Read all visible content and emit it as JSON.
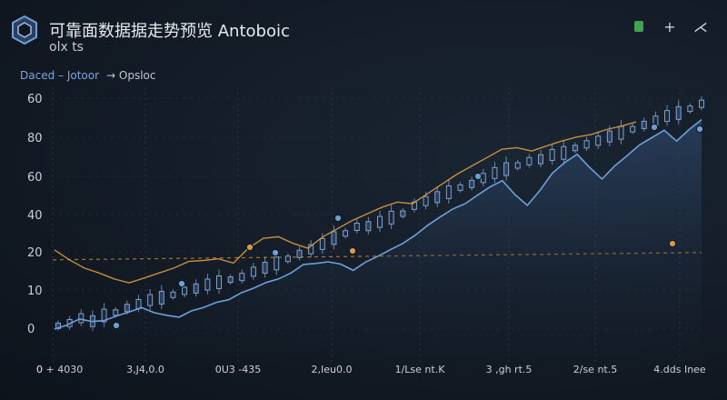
{
  "header": {
    "title": "可靠面数据据走势预览  Antoboic",
    "subtitle": "olx ts"
  },
  "window_controls": [
    {
      "name": "status-icon"
    },
    {
      "name": "add-icon",
      "glyph": "+"
    },
    {
      "name": "share-icon",
      "glyph": "⋌"
    }
  ],
  "legend": {
    "items": [
      "Daced – Jotoor",
      "→ Opsloc"
    ]
  },
  "colors": {
    "price_line": "#6f9fd9",
    "orange_line": "#d89a42",
    "candle": "#7fa3cf",
    "grid": "#2a3543",
    "dash": "#c9892f"
  },
  "chart_data": {
    "type": "line",
    "title": "",
    "xlabel": "",
    "ylabel": "",
    "ylim": [
      0,
      60
    ],
    "yticks": [
      0,
      10,
      20,
      40,
      60,
      80,
      60
    ],
    "xticks": [
      "0 + 4030",
      "3,J4,0.0",
      "0U3 -435",
      "2,Ieu0.0",
      "1/Lse nt.K",
      "3 ,gh rt.5",
      "2/se nt.5",
      "4.dds Inee"
    ],
    "grid": true,
    "series": [
      {
        "kind": "line",
        "values": [
          0.0,
          1.2,
          3.1,
          2.3,
          2.6,
          4.0,
          5.2,
          6.5,
          5.0,
          4.2,
          3.6,
          5.5,
          6.6,
          8.1,
          8.9,
          11.0,
          12.4,
          14.1,
          15.2,
          17.0,
          19.6,
          19.9,
          20.4,
          19.7,
          17.8,
          20.3,
          22.1,
          24.1,
          26.0,
          28.5,
          31.5,
          34.0,
          36.4,
          38.0,
          40.6,
          43.1,
          45.0,
          40.8,
          37.5,
          42.0,
          47.2,
          50.5,
          53.0,
          49.0,
          45.5,
          49.4,
          52.5,
          55.8,
          58.0,
          60.3,
          57.0,
          60.5,
          63.5
        ]
      },
      {
        "kind": "candles",
        "values": [
          1.0,
          1.8,
          3.3,
          2.4,
          4.1,
          5.0,
          6.4,
          7.6,
          8.8,
          9.5,
          10.4,
          11.6,
          12.3,
          13.5,
          14.2,
          15.0,
          15.8,
          17.4,
          18.6,
          19.9,
          21.3,
          22.8,
          24.2,
          25.8,
          27.6,
          29.0,
          31.0,
          31.2,
          32.5,
          33.8,
          35.0,
          37.4,
          38.8,
          40.0,
          41.5,
          42.9,
          44.0,
          45.8,
          47.3,
          48.5,
          49.6,
          50.9,
          51.5,
          52.8,
          53.4,
          54.9,
          56.0,
          57.1,
          58.4,
          59.5,
          60.6,
          61.9,
          63.2,
          64.6,
          65.5,
          66.8,
          68.3
        ]
      },
      {
        "kind": "line-orange",
        "values": [
          24.0,
          21.0,
          18.5,
          17.0,
          15.2,
          14.0,
          15.5,
          17.0,
          18.5,
          20.5,
          20.8,
          21.3,
          20.0,
          24.5,
          27.5,
          28.0,
          26.0,
          24.5,
          28.0,
          30.5,
          33.0,
          35.0,
          37.0,
          38.5,
          38.0,
          41.0,
          44.0,
          47.0,
          49.5,
          52.0,
          54.5,
          55.0,
          54.0,
          55.5,
          57.0,
          58.2,
          59.0,
          60.5,
          61.5,
          62.8
        ]
      }
    ],
    "dashed_level": 21
  }
}
